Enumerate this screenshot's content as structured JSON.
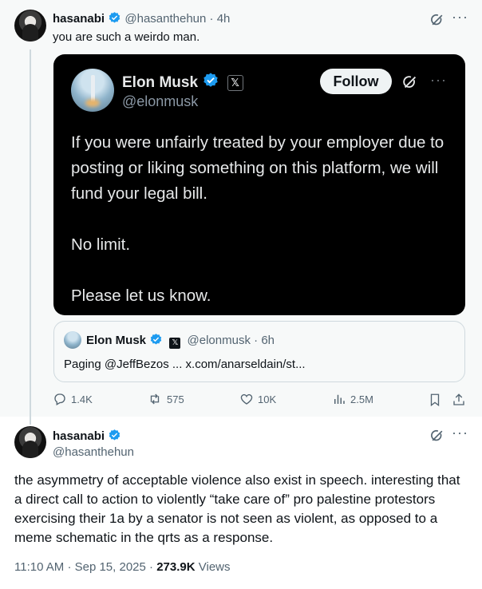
{
  "post1": {
    "name": "hasanabi",
    "handle": "@hasanthehun",
    "separator": "·",
    "time": "4h",
    "text": "you are such a weirdo man."
  },
  "embedded_screenshot": {
    "name": "Elon Musk",
    "handle": "@elonmusk",
    "x_badge": "𝕏",
    "follow_label": "Follow",
    "paragraphs": [
      "If you were unfairly treated by your employer due to posting or liking something on this platform, we will fund your legal bill.",
      "No limit.",
      "Please let us know."
    ]
  },
  "quote": {
    "name": "Elon Musk",
    "x_badge": "𝕏",
    "handle": "@elonmusk",
    "separator": "·",
    "time": "6h",
    "text": "Paging @JeffBezos ... x.com/anarseldain/st..."
  },
  "actions": {
    "replies": "1.4K",
    "reposts": "575",
    "likes": "10K",
    "views": "2.5M"
  },
  "post2": {
    "name": "hasanabi",
    "handle": "@hasanthehun",
    "text": "the asymmetry of acceptable violence also exist in speech. interesting that a direct call to action to violently “take care of” pro palestine protestors exercising their 1a by a senator is not seen as violent, as opposed to a meme schematic in the qrts as a response.",
    "time": "11:10 AM",
    "date": "Sep 15, 2025",
    "views_count": "273.9K",
    "views_label": "Views"
  },
  "colors": {
    "verified": "#1d9bf0",
    "text_primary": "#0f1419",
    "text_secondary": "#536471",
    "thread_bg": "#f7f9f9"
  },
  "icons": [
    "verified-badge-icon",
    "grok-icon",
    "more-icon",
    "reply-icon",
    "repost-icon",
    "like-icon",
    "views-icon",
    "bookmark-icon",
    "share-icon"
  ]
}
